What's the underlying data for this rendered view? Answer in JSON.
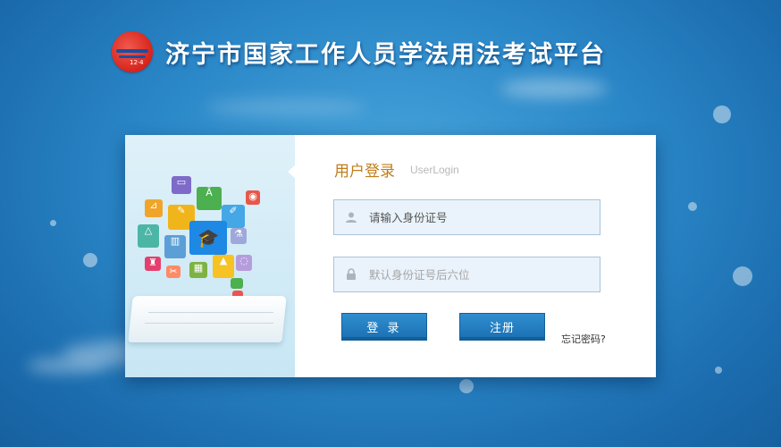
{
  "header": {
    "logo_icon": "jining-emblem-logo",
    "logo_number": "12·4",
    "title": "济宁市国家工作人员学法用法考试平台"
  },
  "login": {
    "title": "用户登录",
    "subtitle": "UserLogin",
    "username": {
      "placeholder": "请输入身份证号",
      "icon": "user-icon"
    },
    "password": {
      "placeholder": "默认身份证号后六位",
      "icon": "lock-icon"
    },
    "login_button": "登 录",
    "register_button": "注册",
    "forgot_link": "忘记密码?"
  },
  "colors": {
    "background": "#2b88c8",
    "accent_title": "#c07d1a",
    "button": "#1f7cc0",
    "field_bg": "#eaf3fb"
  }
}
